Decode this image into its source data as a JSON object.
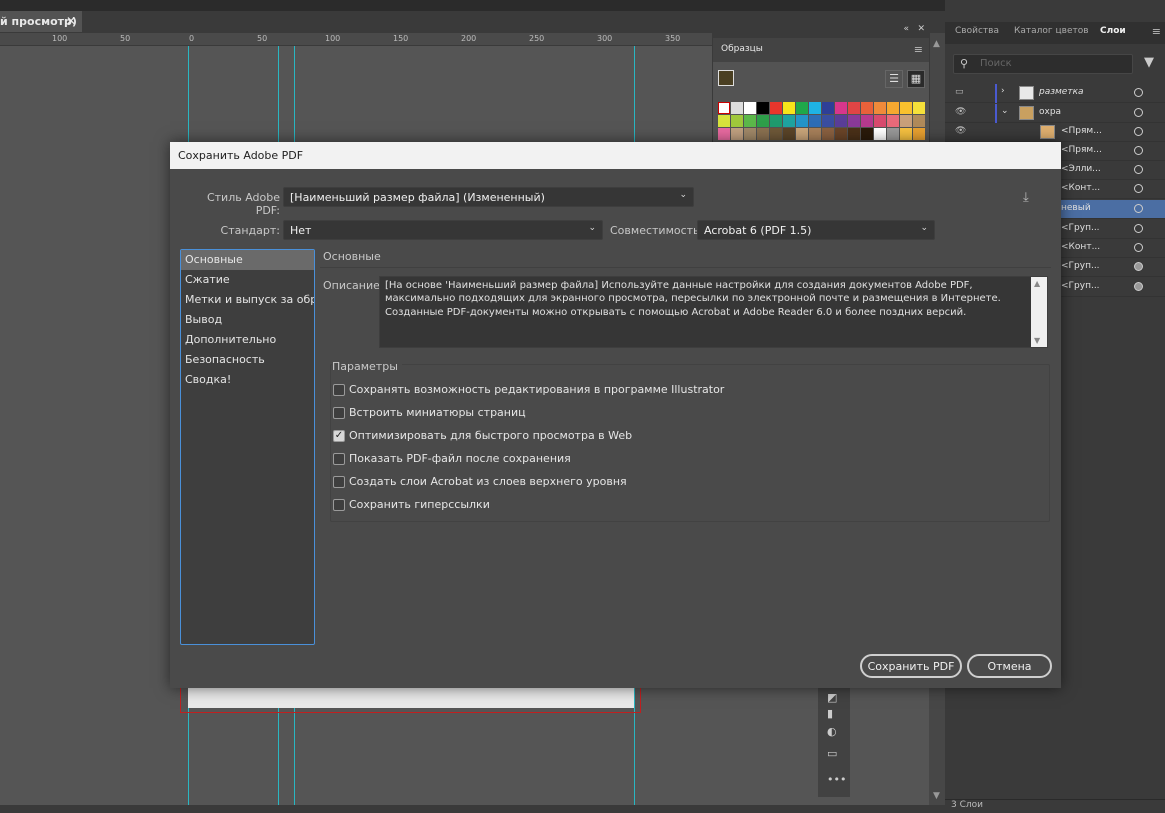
{
  "document_tab": {
    "title": "й просмотр)",
    "close": "✕"
  },
  "ruler": {
    "ticks": [
      "100",
      "50",
      "0",
      "50",
      "100",
      "150",
      "200",
      "250",
      "300",
      "350"
    ]
  },
  "swatches_panel": {
    "title": "Образцы",
    "close": "✕",
    "collapse": "«",
    "menu": "≡"
  },
  "right_panel": {
    "tabs": [
      "Свойства",
      "Каталог цветов",
      "Слои"
    ],
    "search_placeholder": "Поиск",
    "layers": [
      {
        "name": "разметка",
        "arrow": "›"
      },
      {
        "name": "охра",
        "arrow": "⌄"
      },
      {
        "name": "<Прям..."
      },
      {
        "name": "<Прям..."
      },
      {
        "name": "<Элли..."
      },
      {
        "name": "<Конт..."
      },
      {
        "name": "невый"
      },
      {
        "name": "<Груп..."
      },
      {
        "name": "<Конт..."
      },
      {
        "name": "<Груп..."
      },
      {
        "name": "<Груп..."
      }
    ],
    "footer": "3 Слои"
  },
  "dialog": {
    "title": "Сохранить Adobe PDF",
    "style_label": "Стиль Adobe PDF:",
    "style_value": "[Наименьший размер файла] (Измененный)",
    "standard_label": "Стандарт:",
    "standard_value": "Нет",
    "compat_label": "Совместимость:",
    "compat_value": "Acrobat 6 (PDF 1.5)",
    "nav": [
      "Основные",
      "Сжатие",
      "Метки и выпуск за обрез",
      "Вывод",
      "Дополнительно",
      "Безопасность",
      "Сводка!"
    ],
    "section_title": "Основные",
    "description_label": "Описание:",
    "description": "[На основе 'Наименьший размер файла] Используйте данные настройки для создания документов Adobe PDF, максимально подходящих для экранного просмотра, пересылки по электронной почте и размещения в Интернете.  Созданные PDF-документы можно открывать с помощью Acrobat и Adobe Reader 6.0 и более поздних версий.",
    "params_title": "Параметры",
    "options": [
      {
        "label": "Сохранять возможность редактирования в программе Illustrator",
        "checked": false
      },
      {
        "label": "Встроить миниатюры страниц",
        "checked": false
      },
      {
        "label": "Оптимизировать для быстрого просмотра в Web",
        "checked": true
      },
      {
        "label": "Показать PDF-файл после сохранения",
        "checked": false
      },
      {
        "label": "Создать слои Acrobat из слоев верхнего уровня",
        "checked": false
      },
      {
        "label": "Сохранить гиперссылки",
        "checked": false
      }
    ],
    "save_button": "Сохранить PDF",
    "cancel_button": "Отмена"
  }
}
